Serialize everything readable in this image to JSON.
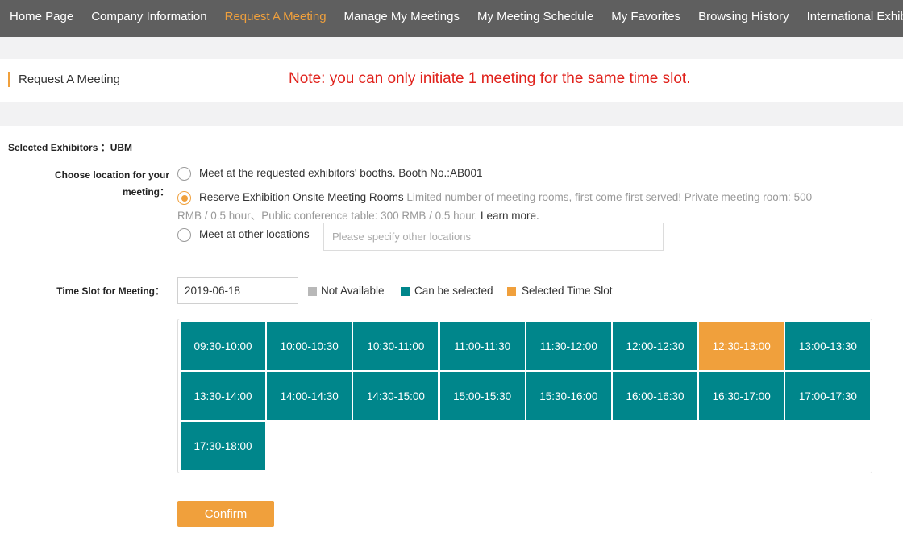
{
  "nav": {
    "items": [
      {
        "label": "Home Page"
      },
      {
        "label": "Company Information"
      },
      {
        "label": "Request A Meeting",
        "active": true
      },
      {
        "label": "Manage My Meetings"
      },
      {
        "label": "My Meeting Schedule"
      },
      {
        "label": "My Favorites"
      },
      {
        "label": "Browsing History"
      },
      {
        "label": "International Exhibitors"
      }
    ]
  },
  "header": {
    "title": "Request A Meeting",
    "note": "Note: you can only initiate 1 meeting for the same time slot."
  },
  "form": {
    "selected_exhibitors": "Selected Exhibitors ：UBM",
    "location_label_1": "Choose location for your",
    "location_label_2": "meeting：",
    "options": {
      "booth": "Meet at the requested exhibitors' booths. Booth No.:AB001",
      "rooms": "Reserve Exhibition Onsite Meeting Rooms",
      "rooms_info_1": "Limited number of meeting rooms, first come first served! Private meeting room: 500",
      "rooms_info_2": "RMB / 0.5 hour、Public conference table: 300 RMB / 0.5 hour.",
      "learn_more": "Learn more.",
      "other": "Meet at other locations",
      "selected": "rooms"
    },
    "other_placeholder": "Please specify other locations",
    "time_slot_label": "Time Slot for Meeting：",
    "date_value": "2019-06-18",
    "legend": {
      "not_available": "Not Available",
      "can_select": "Can be selected",
      "selected": "Selected Time Slot"
    },
    "slots": [
      {
        "label": "09:30-10:00",
        "state": "available"
      },
      {
        "label": "10:00-10:30",
        "state": "available"
      },
      {
        "label": "10:30-11:00",
        "state": "available"
      },
      {
        "label": "11:00-11:30",
        "state": "available"
      },
      {
        "label": "11:30-12:00",
        "state": "available"
      },
      {
        "label": "12:00-12:30",
        "state": "available"
      },
      {
        "label": "12:30-13:00",
        "state": "selected"
      },
      {
        "label": "13:00-13:30",
        "state": "available"
      },
      {
        "label": "13:30-14:00",
        "state": "available"
      },
      {
        "label": "14:00-14:30",
        "state": "available"
      },
      {
        "label": "14:30-15:00",
        "state": "available"
      },
      {
        "label": "15:00-15:30",
        "state": "available"
      },
      {
        "label": "15:30-16:00",
        "state": "available"
      },
      {
        "label": "16:00-16:30",
        "state": "available"
      },
      {
        "label": "16:30-17:00",
        "state": "available"
      },
      {
        "label": "17:00-17:30",
        "state": "available"
      },
      {
        "label": "17:30-18:00",
        "state": "available"
      }
    ],
    "confirm_label": "Confirm"
  },
  "colors": {
    "nav_bg": "#5f5f5f",
    "accent": "#f0a03c",
    "note": "#e0211b",
    "available": "#00868b",
    "not_available": "#b8b8b8",
    "selected": "#f0a03c"
  }
}
